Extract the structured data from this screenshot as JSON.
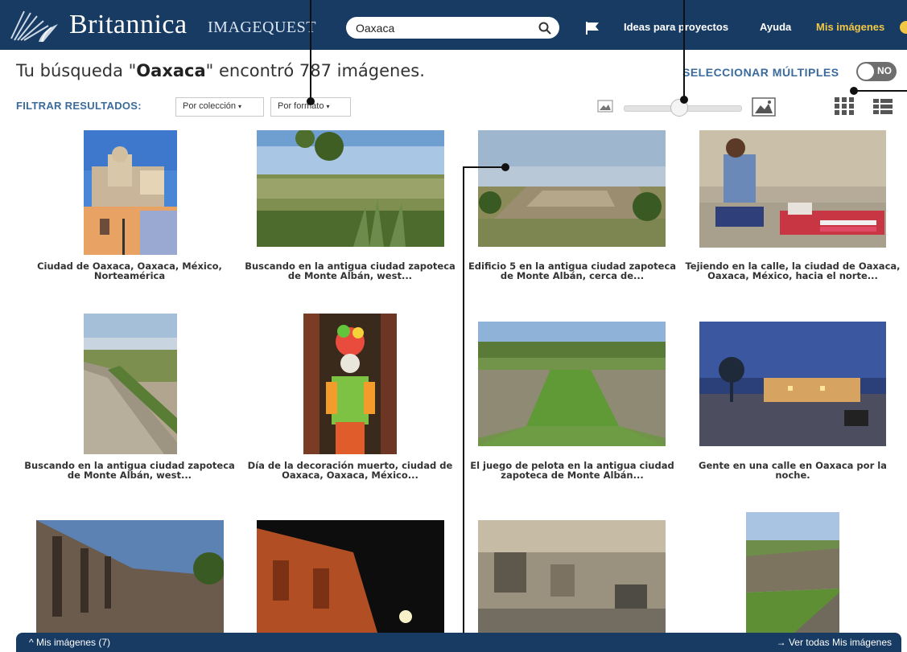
{
  "header": {
    "logo_name": "Britannica",
    "logo_sub": "IMAGEQUEST",
    "search_value": "Oaxaca",
    "nav": {
      "projects": "Ideas para proyectos",
      "help": "Ayuda",
      "my_images": "Mis imágenes"
    },
    "icons": [
      "thistle-logo-icon",
      "search-icon",
      "flag-icon"
    ]
  },
  "results": {
    "prefix": "Tu búsqueda \"",
    "query": "Oaxaca",
    "suffix": "\" encontró 787 imágenes."
  },
  "select_multiple": {
    "label": "SELECCIONAR MÚLTIPLES",
    "toggle_text": "NO"
  },
  "filters": {
    "label": "FILTRAR RESULTADOS:",
    "by_collection": "Por colección",
    "by_format": "Por formato",
    "caret": "▾"
  },
  "view": {
    "thumbnail_size_level": 0.4,
    "grid_icon": "grid-view-icon",
    "list_icon": "list-view-icon"
  },
  "images": [
    {
      "caption": "Ciudad de Oaxaca, Oaxaca, México, Norteamérica",
      "scene": "church"
    },
    {
      "caption": "Buscando en la antigua ciudad zapoteca de Monte Albán, west...",
      "scene": "landscape"
    },
    {
      "caption": "Edificio 5 en la antigua ciudad zapoteca de Monte Albán, cerca de...",
      "scene": "ruins"
    },
    {
      "caption": "Tejiendo en la calle, la ciudad de Oaxaca, Oaxaca, México, hacia el norte...",
      "scene": "weaver"
    },
    {
      "caption": "Buscando en la antigua ciudad zapoteca de Monte Albán, west...",
      "scene": "steps"
    },
    {
      "caption": "Día de la decoración muerto, ciudad de Oaxaca, Oaxaca, México...",
      "scene": "skeleton"
    },
    {
      "caption": "El juego de pelota en la antigua ciudad zapoteca de Monte Albán...",
      "scene": "ballcourt"
    },
    {
      "caption": "Gente en una calle en Oaxaca por la noche.",
      "scene": "night"
    },
    {
      "caption": "",
      "scene": "street"
    },
    {
      "caption": "",
      "scene": "facade"
    },
    {
      "caption": "",
      "scene": "museum"
    },
    {
      "caption": "",
      "scene": "pyramid"
    }
  ],
  "footer": {
    "left": "Mis imágenes (7)",
    "right": "Ver todas Mis imágenes"
  },
  "colors": {
    "header_bg": "#173b63",
    "accent": "#3a6b9c",
    "highlight": "#f2c744"
  }
}
